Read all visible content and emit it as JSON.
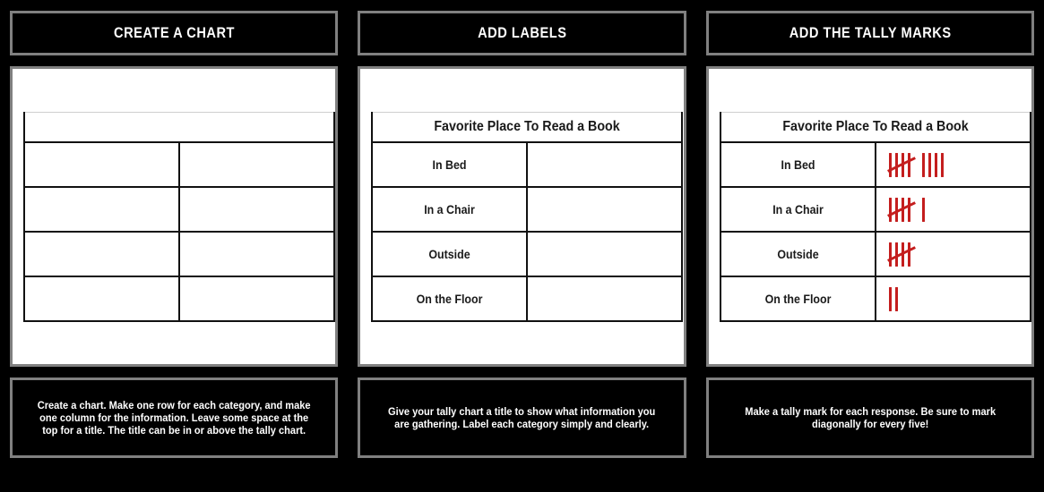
{
  "board": {
    "background_color": "#000000",
    "panel_border_color": "#808080",
    "tally_color": "#C41E1E"
  },
  "panels": [
    {
      "header": "CREATE A CHART",
      "caption": "Create a chart. Make one row for each category, and make one column for the information. Leave some space at the top for a title. The title can be in or above the tally chart.",
      "chart": {
        "title": "",
        "rows": [
          {
            "label": "",
            "tally_count": 0
          },
          {
            "label": "",
            "tally_count": 0
          },
          {
            "label": "",
            "tally_count": 0
          },
          {
            "label": "",
            "tally_count": 0
          }
        ]
      }
    },
    {
      "header": "ADD LABELS",
      "caption": "Give your tally chart a title to show what information you are gathering. Label each category simply and clearly.",
      "chart": {
        "title": "Favorite Place To Read a Book",
        "rows": [
          {
            "label": "In Bed",
            "tally_count": 0
          },
          {
            "label": "In a Chair",
            "tally_count": 0
          },
          {
            "label": "Outside",
            "tally_count": 0
          },
          {
            "label": "On the Floor",
            "tally_count": 0
          }
        ]
      }
    },
    {
      "header": "ADD THE TALLY MARKS",
      "caption": "Make a tally mark for each response. Be sure to mark diagonally for every five!",
      "chart": {
        "title": "Favorite Place To Read a Book",
        "rows": [
          {
            "label": "In Bed",
            "tally_count": 9
          },
          {
            "label": "In a Chair",
            "tally_count": 6
          },
          {
            "label": "Outside",
            "tally_count": 5
          },
          {
            "label": "On the Floor",
            "tally_count": 2
          }
        ]
      }
    }
  ],
  "chart_data": {
    "type": "table",
    "title": "Favorite Place To Read a Book",
    "xlabel": "",
    "ylabel": "",
    "categories": [
      "In Bed",
      "In a Chair",
      "Outside",
      "On the Floor"
    ],
    "values": [
      9,
      6,
      5,
      2
    ],
    "notation": "tally-marks",
    "legend": []
  }
}
